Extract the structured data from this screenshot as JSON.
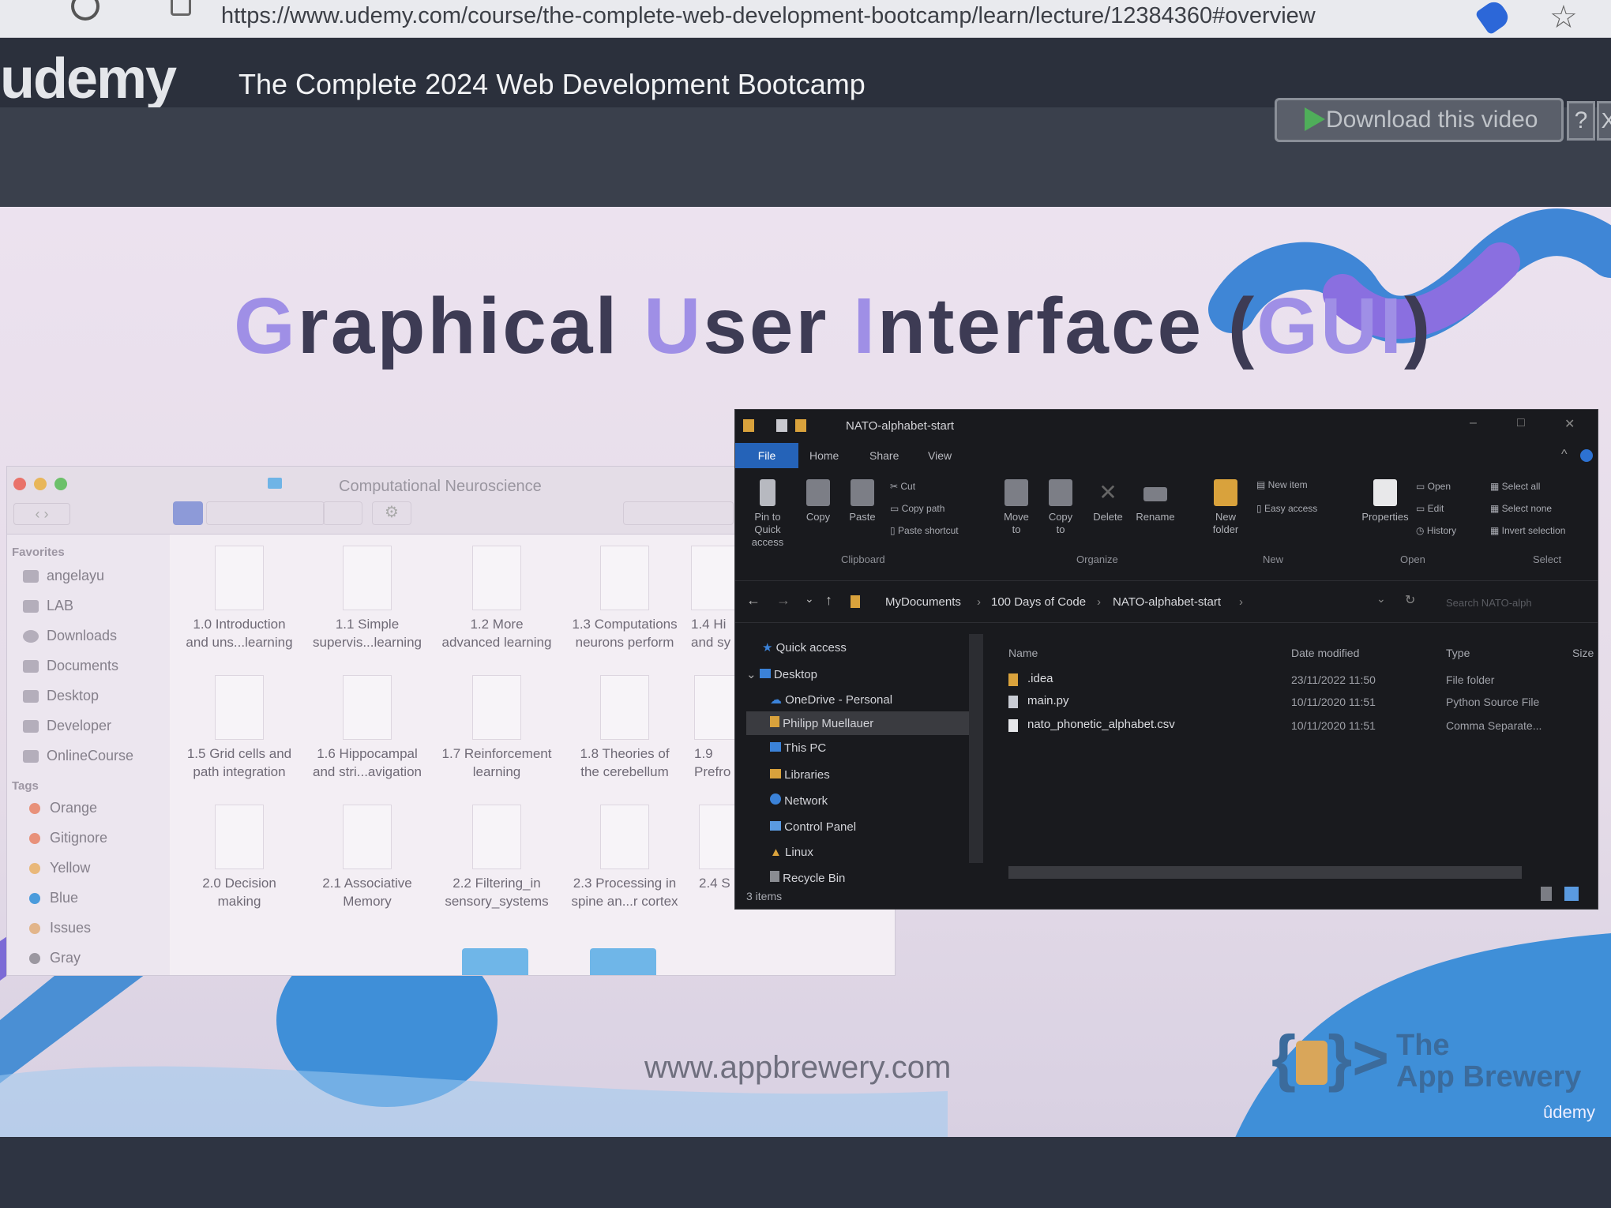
{
  "browser": {
    "url": "https://www.udemy.com/course/the-complete-web-development-bootcamp/learn/lecture/12384360#overview"
  },
  "header": {
    "logo": "udemy",
    "course_title": "The Complete 2024 Web Development Bootcamp",
    "download_label": "Download this video",
    "help_label": "?",
    "close_label": "X"
  },
  "slide": {
    "title_parts": [
      "G",
      "raphical ",
      "U",
      "ser ",
      "I",
      "nterface (",
      "GUI",
      ")"
    ],
    "footer_url": "www.appbrewery.com",
    "brand_line1": "The",
    "brand_line2": "App Brewery",
    "udemy_watermark": "ûdemy"
  },
  "finder": {
    "title": "Computational Neuroscience",
    "favorites_heading": "Favorites",
    "favorites": [
      "angelayu",
      "LAB",
      "Downloads",
      "Documents",
      "Desktop",
      "Developer",
      "OnlineCourse"
    ],
    "tags_heading": "Tags",
    "tags": [
      {
        "label": "Orange",
        "color": "#e8917a"
      },
      {
        "label": "Gitignore",
        "color": "#e8917a"
      },
      {
        "label": "Yellow",
        "color": "#e9b87a"
      },
      {
        "label": "Blue",
        "color": "#4a9bdc"
      },
      {
        "label": "Issues",
        "color": "#e2b58a"
      },
      {
        "label": "Gray",
        "color": "#9b97a0"
      }
    ],
    "files": [
      [
        "1.0 Introduction",
        "and uns...learning"
      ],
      [
        "1.1 Simple",
        "supervis...learning"
      ],
      [
        "1.2 More",
        "advanced learning"
      ],
      [
        "1.3 Computations",
        "neurons perform"
      ],
      [
        "1.4 Hi",
        "and sy"
      ],
      [
        "1.5 Grid cells and",
        "path integration"
      ],
      [
        "1.6 Hippocampal",
        "and stri...avigation"
      ],
      [
        "1.7 Reinforcement",
        "learning"
      ],
      [
        "1.8 Theories of",
        "the cerebellum"
      ],
      [
        "1.9",
        "Prefro"
      ],
      [
        "2.0 Decision",
        "making"
      ],
      [
        "2.1 Associative",
        "Memory"
      ],
      [
        "2.2 Filtering_in",
        "sensory_systems"
      ],
      [
        "2.3 Processing in",
        "spine an...r cortex"
      ],
      [
        "2.4 S",
        ""
      ]
    ]
  },
  "explorer": {
    "title": "NATO-alphabet-start",
    "tabs": [
      "File",
      "Home",
      "Share",
      "View"
    ],
    "clipboard": {
      "pin": "Pin to Quick access",
      "copy": "Copy",
      "paste": "Paste",
      "cut": "Cut",
      "copy_path": "Copy path",
      "paste_shortcut": "Paste shortcut",
      "label": "Clipboard"
    },
    "organize": {
      "move": "Move to",
      "copy_to": "Copy to",
      "delete": "Delete",
      "rename": "Rename",
      "label": "Organize"
    },
    "new": {
      "folder": "New folder",
      "item": "New item",
      "easy": "Easy access",
      "label": "New"
    },
    "open": {
      "properties": "Properties",
      "open": "Open",
      "edit": "Edit",
      "history": "History",
      "label": "Open"
    },
    "select": {
      "all": "Select all",
      "none": "Select none",
      "invert": "Invert selection",
      "label": "Select"
    },
    "breadcrumb": [
      "MyDocuments",
      "100 Days of Code",
      "NATO-alphabet-start"
    ],
    "search_placeholder": "Search NATO-alph",
    "nav": [
      "Quick access",
      "Desktop",
      "OneDrive - Personal",
      "Philipp Muellauer",
      "This PC",
      "Libraries",
      "Network",
      "Control Panel",
      "Linux",
      "Recycle Bin"
    ],
    "columns": [
      "Name",
      "Date modified",
      "Type",
      "Size"
    ],
    "rows": [
      {
        "name": ".idea",
        "date": "23/11/2022 11:50",
        "type": "File folder"
      },
      {
        "name": "main.py",
        "date": "10/11/2020 11:51",
        "type": "Python Source File"
      },
      {
        "name": "nato_phonetic_alphabet.csv",
        "date": "10/11/2020 11:51",
        "type": "Comma Separate..."
      }
    ],
    "status": "3 items"
  }
}
